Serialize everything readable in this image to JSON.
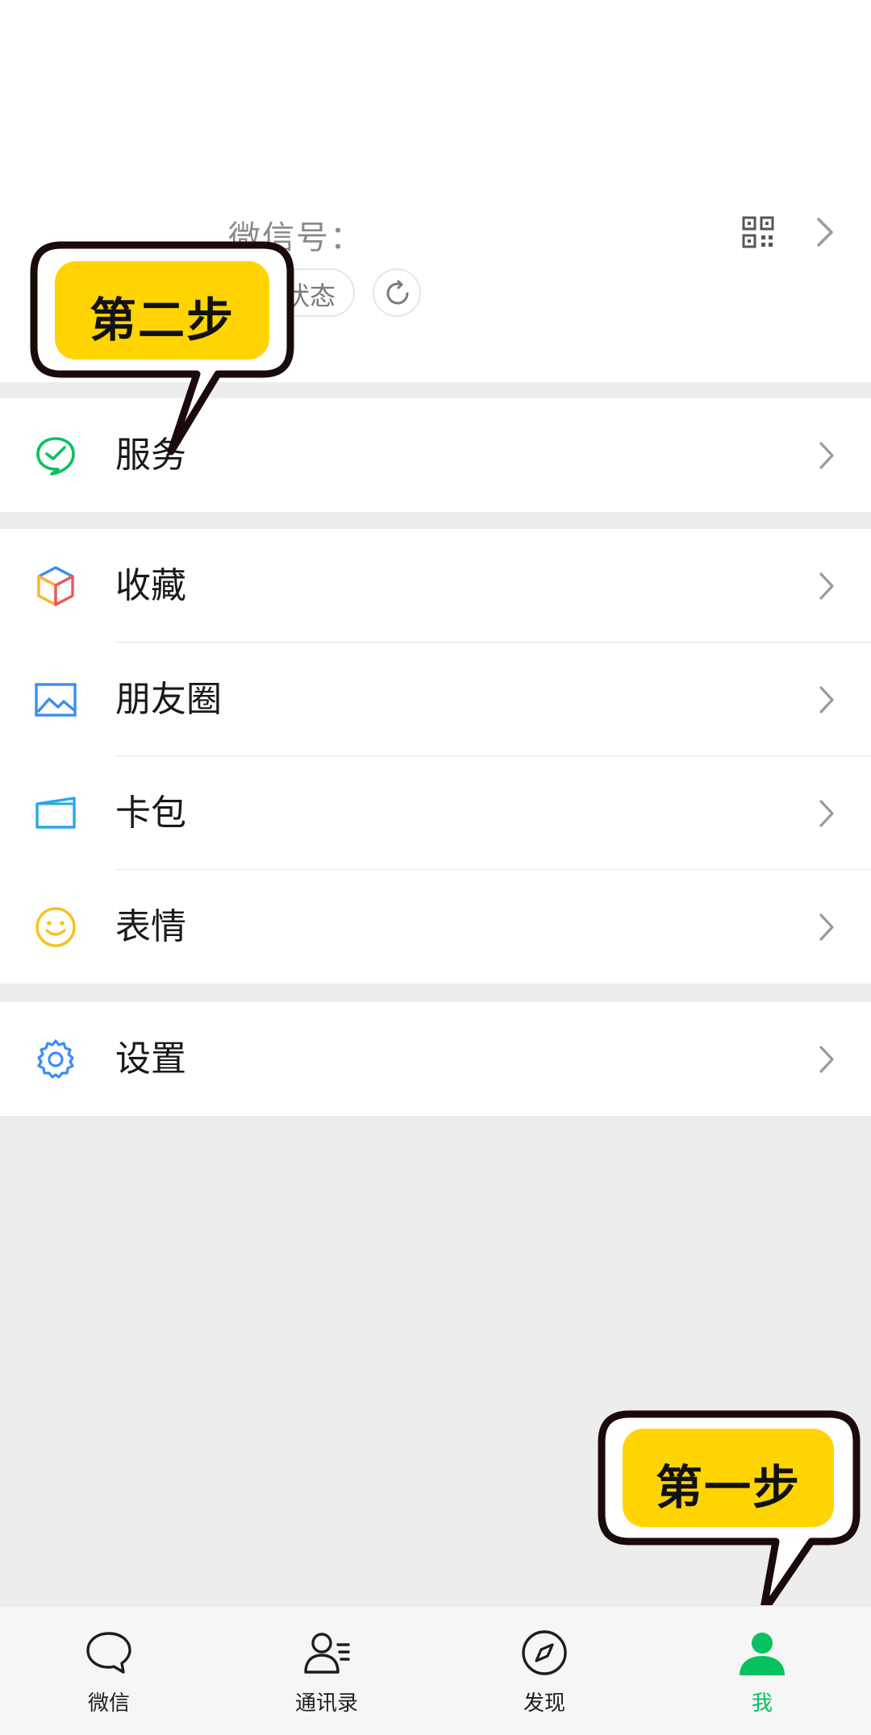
{
  "profile": {
    "wechat_id_label": "微信号：",
    "status_label": "状态"
  },
  "menu": {
    "services": "服务",
    "favorites": "收藏",
    "moments": "朋友圈",
    "card_wallet": "卡包",
    "stickers": "表情",
    "settings": "设置"
  },
  "tabbar": {
    "chats": "微信",
    "contacts": "通讯录",
    "discover": "发现",
    "me": "我"
  },
  "callouts": {
    "step_two": "第二步",
    "step_one": "第一步"
  },
  "colors": {
    "brand_green": "#07c160",
    "callout_yellow": "#ffd400",
    "callout_border": "#1a0a0a"
  }
}
